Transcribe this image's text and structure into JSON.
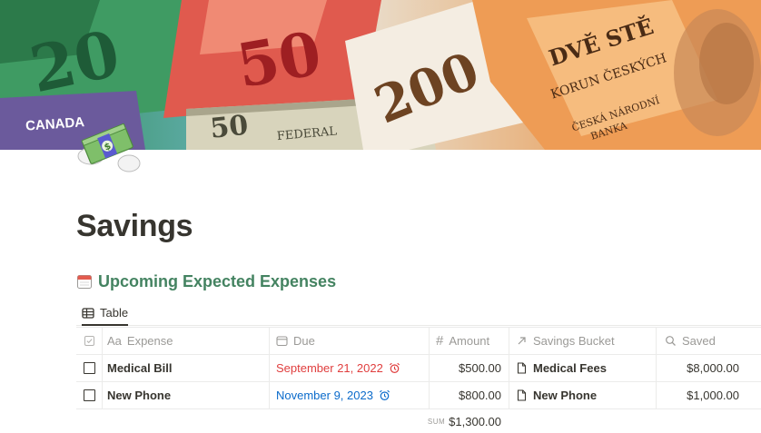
{
  "cover": {
    "canada_text": "CANADA",
    "note_20": "20",
    "note_50_red": "50",
    "note_200": "200",
    "note_50_usd": "50",
    "usd_text": "FEDERAL",
    "czech_line1": "DVĚ STĚ",
    "czech_line2": "KORUN ČESKÝCH",
    "czech_bank1": "ČESKÁ NÁRODNÍ",
    "czech_bank2": "BANKA"
  },
  "page": {
    "icon": "money-with-wings-icon",
    "title": "Savings"
  },
  "section": {
    "icon": "calendar-icon",
    "heading": "Upcoming Expected Expenses"
  },
  "view": {
    "tab_label": "Table",
    "tab_icon": "table-icon"
  },
  "table": {
    "columns": [
      {
        "icon": "checkbox-icon",
        "label": ""
      },
      {
        "icon": "text-prop-icon",
        "label": "Expense",
        "prefix": "Aa"
      },
      {
        "icon": "calendar-prop-icon",
        "label": "Due"
      },
      {
        "icon": "number-prop-icon",
        "label": "Amount",
        "prefix": "#"
      },
      {
        "icon": "relation-arrow-icon",
        "label": "Savings Bucket"
      },
      {
        "icon": "rollup-search-icon",
        "label": "Saved"
      }
    ],
    "rows": [
      {
        "expense": "Medical Bill",
        "due": "September 21, 2022",
        "due_color": "#e03e3e",
        "amount": "$500.00",
        "bucket": "Medical Fees",
        "saved": "$8,000.00"
      },
      {
        "expense": "New Phone",
        "due": "November 9, 2023",
        "due_color": "#0b6bcb",
        "amount": "$800.00",
        "bucket": "New Phone",
        "saved": "$1,000.00"
      }
    ],
    "summary": {
      "label": "SUM",
      "value": "$1,300.00"
    }
  }
}
